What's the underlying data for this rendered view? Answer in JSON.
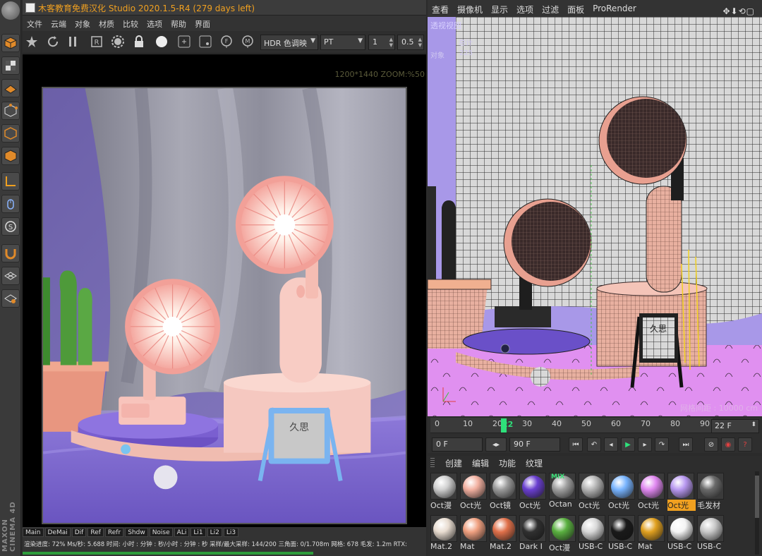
{
  "render_view": {
    "title": "木客教育免费汉化 Studio 2020.1.5-R4 (279 days left)",
    "menu": [
      "文件",
      "云端",
      "对象",
      "材质",
      "比较",
      "选项",
      "帮助",
      "界面"
    ],
    "toolbar": {
      "tonemap_select": "HDR 色调映",
      "kernel_select": "PT",
      "field1_value": "1",
      "field2_value": "0.5"
    },
    "resolution_label": "1200*1440 ZOOM:%50",
    "bottom_tabs": [
      "Main",
      "DeMai",
      "Dif",
      "Ref",
      "Refr",
      "Shdw",
      "Noise",
      "ALi",
      "Li1",
      "Li2",
      "Li3"
    ],
    "status_text": "渲染进度: 72%   Ms/秒: 5.688   时间: 小时 : 分钟 : 秒/小时 : 分钟 : 秒   采样/最大采样: 144/200   三角面: 0/1.708m   网格: 678   毛发: 1.2m   RTX:",
    "progress_fraction": 0.72
  },
  "render_scene": {
    "sign_text": "久思"
  },
  "viewport": {
    "menu": [
      "查看",
      "摄像机",
      "显示",
      "选项",
      "过滤",
      "面板",
      "ProRender"
    ],
    "view_label": "透视视图",
    "stats": [
      {
        "label": "",
        "value": "总计"
      },
      {
        "label": "对象",
        "value": "225"
      }
    ],
    "grid_info": "网格间距 : 10000 cm",
    "sign_text": "久思"
  },
  "timeline": {
    "ticks": [
      "0",
      "10",
      "20",
      "30",
      "40",
      "50",
      "60",
      "70",
      "80",
      "90"
    ],
    "current_frame_label": "22",
    "end_field": "22 F",
    "start_field": "0 F",
    "max_field": "90 F"
  },
  "material_manager": {
    "menu": [
      "创建",
      "编辑",
      "功能",
      "纹理"
    ],
    "materials_row1": [
      {
        "label": "Oct漫",
        "color": "#cfcfcf"
      },
      {
        "label": "Oct光",
        "color": "#f2b0a0"
      },
      {
        "label": "Oct镜",
        "color": "#9a9a9a"
      },
      {
        "label": "Oct光",
        "color": "#6a3fd0"
      },
      {
        "label": "Octan",
        "color": "#a0a0a0"
      },
      {
        "label": "Oct光",
        "color": "#b5b5b5"
      },
      {
        "label": "Oct光",
        "color": "#78b4ff"
      },
      {
        "label": "Oct光",
        "color": "#e088f0"
      },
      {
        "label": "Oct光",
        "color": "#b898f0"
      },
      {
        "label": "毛发材",
        "color": "#6a6a6a"
      }
    ],
    "materials_row2": [
      {
        "label": "Mat.2",
        "color": "#e8dcd0"
      },
      {
        "label": "Mat",
        "color": "#f0a080"
      },
      {
        "label": "Mat.2",
        "color": "#e0704a"
      },
      {
        "label": "Dark I",
        "color": "#303030"
      },
      {
        "label": "Oct漫",
        "color": "#5ab040"
      },
      {
        "label": "USB-C",
        "color": "#d8d8d8"
      },
      {
        "label": "USB-C",
        "color": "#1a1a1a"
      },
      {
        "label": "Mat",
        "color": "#e0a020"
      },
      {
        "label": "USB-C",
        "color": "#f4f4f4"
      },
      {
        "label": "USB-C",
        "color": "#c8c8c8"
      }
    ],
    "mix_badge": "MIX"
  }
}
